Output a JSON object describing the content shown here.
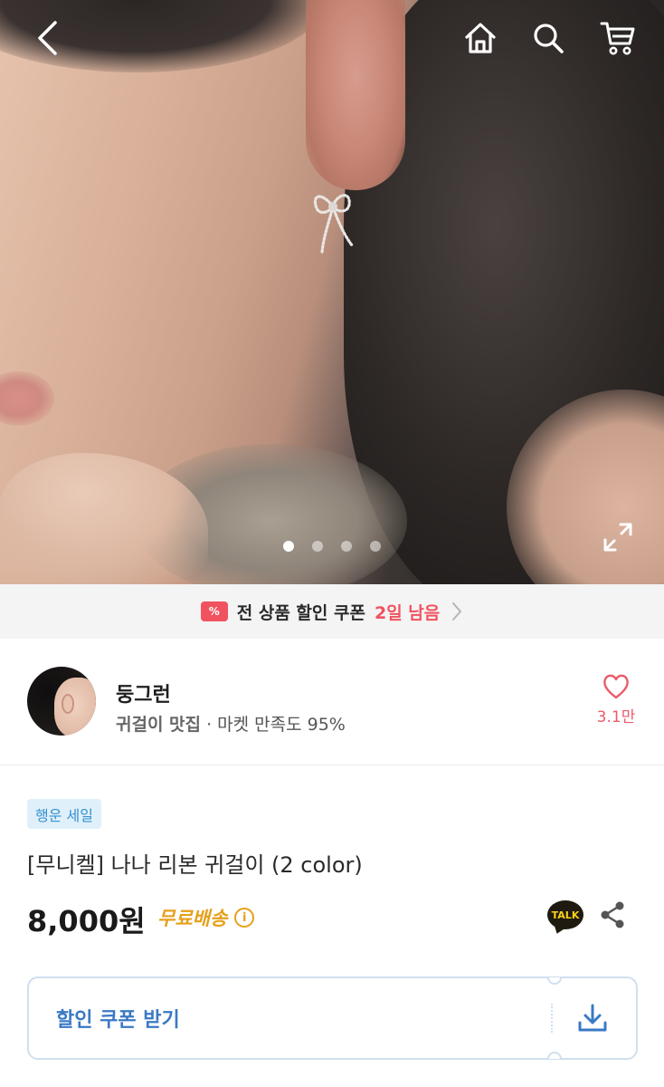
{
  "hero": {
    "image_label": "",
    "carousel_total": 4,
    "carousel_active": 1
  },
  "icons": {
    "back": "chevron-left-icon",
    "home": "home-icon",
    "search": "search-icon",
    "cart": "cart-icon",
    "expand": "expand-icon",
    "coupon": "coupon-ticket-icon",
    "like": "heart-icon",
    "info": "info-icon",
    "talk": "talk-icon",
    "share": "share-icon",
    "download": "download-icon"
  },
  "coupon_banner": {
    "text": "전 상품 할인 쿠폰",
    "highlight": "2일 남음",
    "ticket_symbol": "%"
  },
  "shop": {
    "name": "둥그런",
    "category": "귀걸이 맛집",
    "rating_text": "· 마켓 만족도 95%",
    "likes": "3.1만"
  },
  "product": {
    "badge": "행운 세일",
    "title": "[무니켈] 나나 리본 귀걸이 (2 color)",
    "price": "8,000원",
    "shipping": "무료배송",
    "info_symbol": "i",
    "talk_label": "TALK"
  },
  "coupon_button": {
    "label": "할인 쿠폰 받기"
  },
  "colors": {
    "accent_red": "#f0535f",
    "shipping_yellow": "#e6a01b",
    "coupon_blue": "#3a79c4",
    "badge_bg": "#e0f0fb"
  }
}
